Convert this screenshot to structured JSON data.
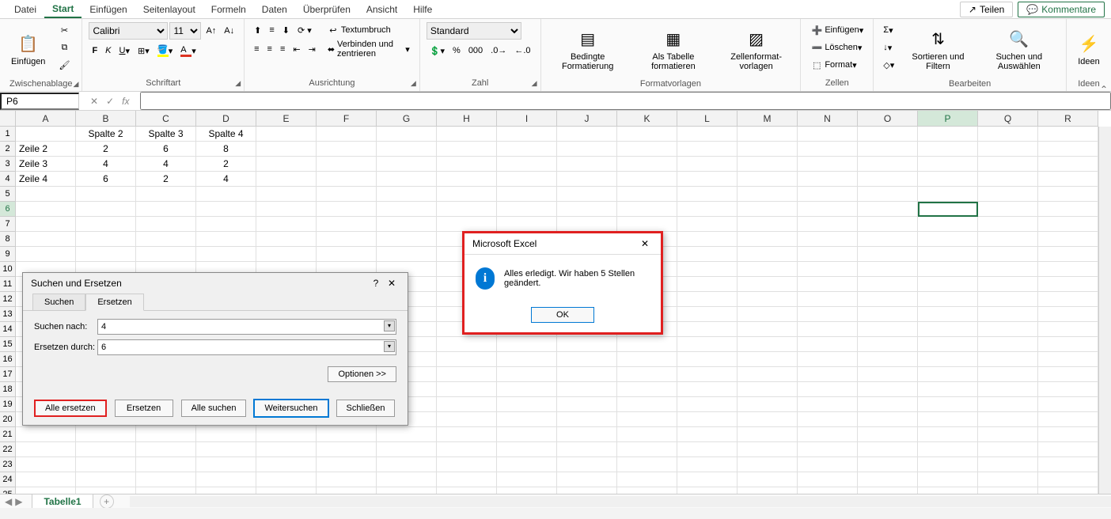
{
  "menu": {
    "items": [
      "Datei",
      "Start",
      "Einfügen",
      "Seitenlayout",
      "Formeln",
      "Daten",
      "Überprüfen",
      "Ansicht",
      "Hilfe"
    ],
    "active_index": 1,
    "share": "Teilen",
    "comments": "Kommentare"
  },
  "ribbon": {
    "clipboard": {
      "paste": "Einfügen",
      "label": "Zwischenablage"
    },
    "font": {
      "name": "Calibri",
      "size": "11",
      "label": "Schriftart"
    },
    "alignment": {
      "wrap": "Textumbruch",
      "merge": "Verbinden und zentrieren",
      "label": "Ausrichtung"
    },
    "number": {
      "format": "Standard",
      "label": "Zahl"
    },
    "styles": {
      "cond": "Bedingte Formatierung",
      "table": "Als Tabelle formatieren",
      "cellstyles": "Zell­en­format­vorlagen",
      "label": "Formatvorlagen"
    },
    "cells": {
      "insert": "Einfügen",
      "delete": "Löschen",
      "format": "Format",
      "label": "Zellen"
    },
    "editing": {
      "sort": "Sortieren und Filtern",
      "find": "Suchen und Auswählen",
      "label": "Bearbeiten"
    },
    "ideas": {
      "btn": "Ideen",
      "label": "Ideen"
    }
  },
  "namebox": "P6",
  "columns": [
    "A",
    "B",
    "C",
    "D",
    "E",
    "F",
    "G",
    "H",
    "I",
    "J",
    "K",
    "L",
    "M",
    "N",
    "O",
    "P",
    "Q",
    "R"
  ],
  "active_col_index": 15,
  "active_row_index": 5,
  "row_count": 25,
  "grid": {
    "headers": [
      "",
      "Spalte 2",
      "Spalte 3",
      "Spalte 4"
    ],
    "rows": [
      [
        "Zeile 2",
        "2",
        "6",
        "8"
      ],
      [
        "Zeile 3",
        "4",
        "4",
        "2"
      ],
      [
        "Zeile 4",
        "6",
        "2",
        "4"
      ]
    ]
  },
  "sheet_tab": "Tabelle1",
  "find_dialog": {
    "title": "Suchen und Ersetzen",
    "tabs": [
      "Suchen",
      "Ersetzen"
    ],
    "active_tab": 1,
    "find_label": "Suchen nach:",
    "find_value": "4",
    "replace_label": "Ersetzen durch:",
    "replace_value": "6",
    "options_btn": "Optionen >>",
    "buttons": [
      "Alle ersetzen",
      "Ersetzen",
      "Alle suchen",
      "Weitersuchen",
      "Schließen"
    ]
  },
  "msgbox": {
    "title": "Microsoft Excel",
    "text": "Alles erledigt. Wir haben 5 Stellen geändert.",
    "ok": "OK"
  }
}
